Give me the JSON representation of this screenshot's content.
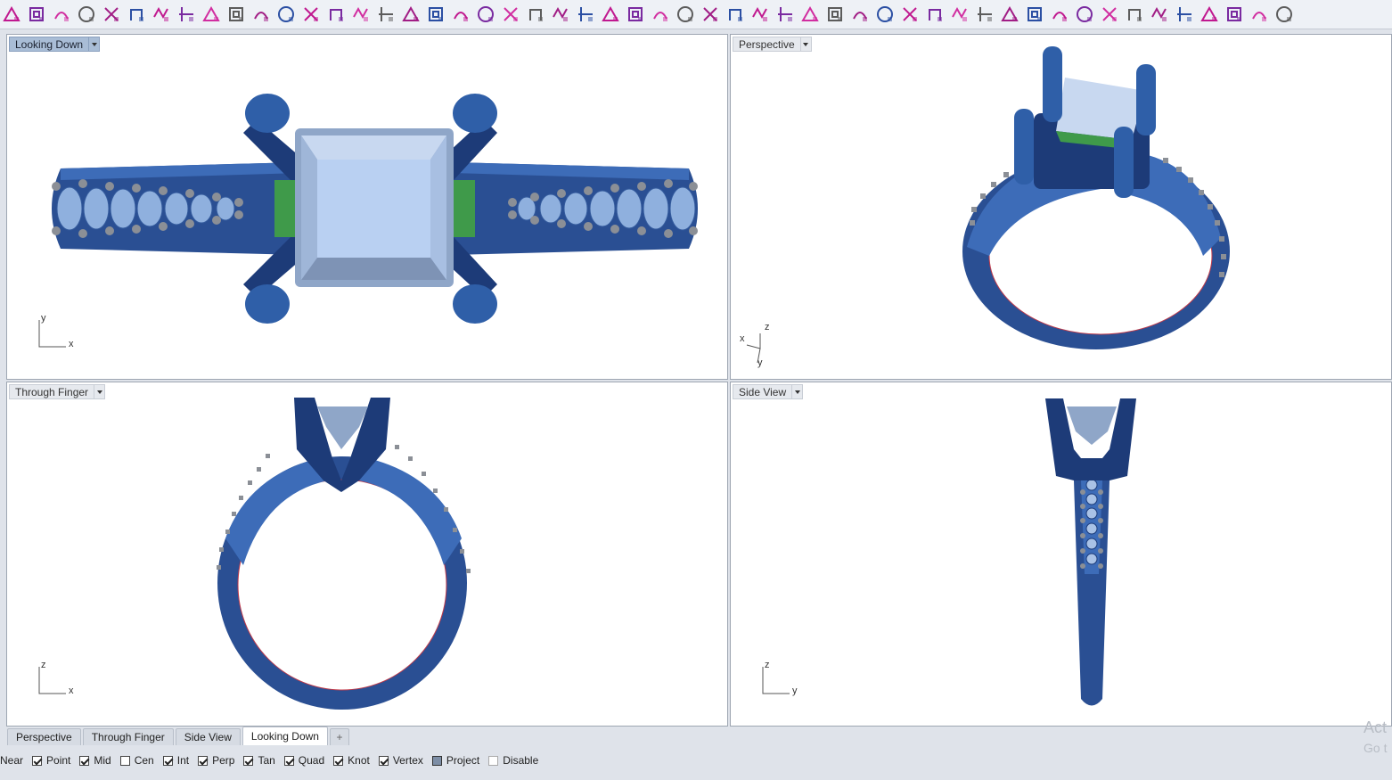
{
  "toolbar": {
    "icons": [
      "point-icon",
      "curve-icon",
      "solid-box-icon",
      "box-icon",
      "sweep-icon",
      "blend-icon",
      "loft-icon",
      "surface-icon",
      "extrude-icon",
      "pipe-icon",
      "revolve-icon",
      "patch-icon",
      "cap-icon",
      "boolean-union-icon",
      "boolean-difference-icon",
      "split-icon",
      "trim-icon",
      "join-icon",
      "explode-icon",
      "fillet-icon",
      "chamfer-icon",
      "shell-icon",
      "offset-icon",
      "array-icon",
      "grid-array-icon",
      "polar-array-icon",
      "mirror-icon",
      "scale-icon",
      "rotate-icon",
      "move-icon",
      "copy-icon",
      "align-icon",
      "orient-icon",
      "flow-icon",
      "twist-icon",
      "bend-icon",
      "taper-icon",
      "cage-icon",
      "mesh-icon",
      "control-points-icon",
      "rebuild-icon",
      "match-icon",
      "gem-icon",
      "prong-icon",
      "pave-icon",
      "ring-size-icon",
      "bezel-icon",
      "shank-icon",
      "render-icon",
      "settings-icon",
      "material-icon",
      "gear-icon"
    ]
  },
  "viewports": {
    "top_left": {
      "title": "Looking Down",
      "axis_a": "y",
      "axis_b": "x"
    },
    "top_right": {
      "title": "Perspective",
      "axis_a": "z",
      "axis_b": "x",
      "axis_c": "y"
    },
    "bottom_left": {
      "title": "Through Finger",
      "axis_a": "z",
      "axis_b": "x"
    },
    "bottom_right": {
      "title": "Side View",
      "axis_a": "z",
      "axis_b": "y"
    }
  },
  "tabs": [
    {
      "label": "Perspective",
      "active": false
    },
    {
      "label": "Through Finger",
      "active": false
    },
    {
      "label": "Side View",
      "active": false
    },
    {
      "label": "Looking Down",
      "active": true
    }
  ],
  "tab_add": "+",
  "osnap": {
    "near": "Near",
    "point": "Point",
    "mid": "Mid",
    "cen": "Cen",
    "int": "Int",
    "perp": "Perp",
    "tan": "Tan",
    "quad": "Quad",
    "knot": "Knot",
    "vertex": "Vertex",
    "project": "Project",
    "disable": "Disable"
  },
  "watermark": {
    "line1": "Act",
    "line2": "Go t"
  },
  "colors": {
    "ring_blue": "#2f5fa8",
    "ring_dark": "#1d3b78",
    "gem": "#b6cdf0",
    "green": "#3f9a4a",
    "prong_gray": "#8b8f96",
    "active_tab": "#a9bdd6"
  }
}
